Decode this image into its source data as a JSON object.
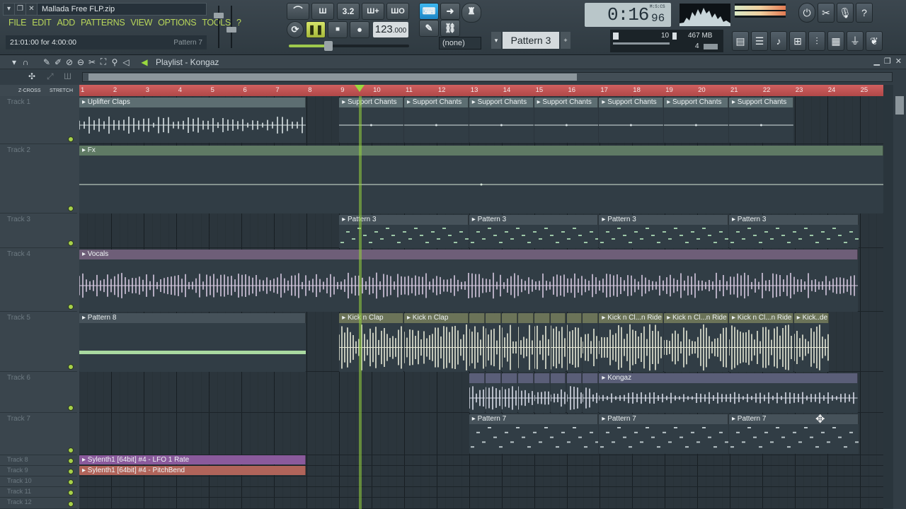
{
  "app": {
    "project_file": "Mallada Free FLP.zip",
    "menu": [
      "FILE",
      "EDIT",
      "ADD",
      "PATTERNS",
      "VIEW",
      "OPTIONS",
      "TOOLS",
      "?"
    ],
    "hint": "21:01:00 for 4:00:00",
    "hint_pattern": "Pattern 7"
  },
  "transport": {
    "tempo_main": "123",
    "tempo_frac": ".000",
    "snap_label": "(none)",
    "pattern": "Pattern 3",
    "time_main": "0:16",
    "time_small": "96",
    "time_unit": "M:S:CS",
    "cpu_value": "10",
    "memory": "467 MB",
    "polyphony": "4",
    "master_slider": 0.33
  },
  "playlist": {
    "title": "Playlist - Kongaz",
    "ruler_left": [
      "Z-CROSS",
      "STRETCH"
    ],
    "bars": [
      "1",
      "2",
      "3",
      "4",
      "5",
      "6",
      "7",
      "8",
      "9",
      "10",
      "11",
      "12",
      "13",
      "14",
      "15",
      "16",
      "17",
      "18",
      "19",
      "20",
      "21",
      "22",
      "23",
      "24",
      "25"
    ],
    "tracks": [
      {
        "name": "Track 1"
      },
      {
        "name": "Track 2"
      },
      {
        "name": "Track 3"
      },
      {
        "name": "Track 4"
      },
      {
        "name": "Track 5"
      },
      {
        "name": "Track 6"
      },
      {
        "name": "Track 7"
      },
      {
        "name": "Track 8"
      },
      {
        "name": "Track 9"
      },
      {
        "name": "Track 10"
      },
      {
        "name": "Track 11"
      },
      {
        "name": "Track 12"
      }
    ],
    "clips": {
      "uplifter": "Uplifter Claps",
      "support": "Support Chants",
      "fx": "Fx",
      "pattern3": "Pattern 3",
      "vocals": "Vocals",
      "pattern8": "Pattern 8",
      "kick": "Kick n Clap",
      "kick_ride": "Kick n Cl...n Ride",
      "kick_end": "Kick..de",
      "kongaz": "Kongaz",
      "pattern7": "Pattern 7",
      "auto1": "Sylenth1 [64bit] #4 - LFO 1 Rate",
      "auto2": "Sylenth1 [64bit] #4 - PitchBend"
    },
    "colors": {
      "track1": "#5d6e72",
      "track2": "#5f7a64",
      "track4": "#6e5e78",
      "track5": "#6b7358",
      "track6": "#5a5e78",
      "auto1": "#8a5a9c",
      "auto2": "#b0645a"
    }
  }
}
